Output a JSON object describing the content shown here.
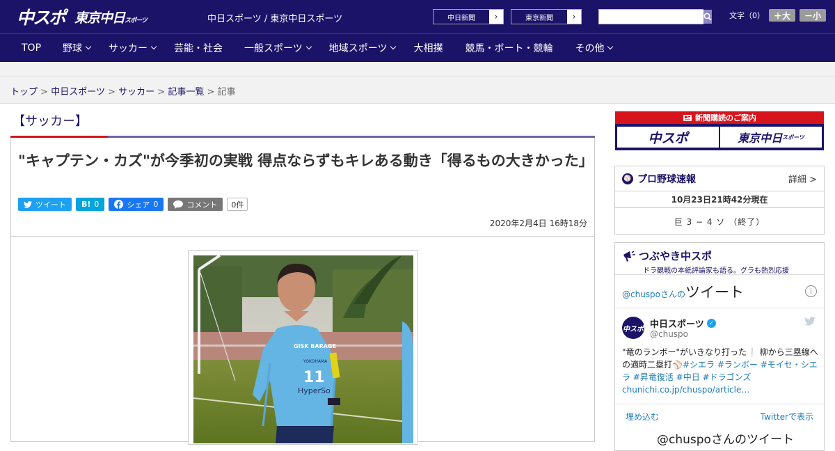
{
  "header": {
    "logo_primary": "中スポ",
    "logo_secondary": "東京中日",
    "logo_secondary_small": "スポーツ",
    "site_title": "中日スポーツ / 東京中日スポーツ",
    "paper_links": [
      "中日新聞",
      "東京新聞"
    ],
    "search": {
      "placeholder": ""
    },
    "font_label": "文字（0）",
    "font_larger": "＋大",
    "font_smaller": "－小"
  },
  "nav": {
    "items": [
      {
        "label": "TOP",
        "has_dropdown": false
      },
      {
        "label": "野球",
        "has_dropdown": true
      },
      {
        "label": "サッカー",
        "has_dropdown": true
      },
      {
        "label": "芸能・社会",
        "has_dropdown": false
      },
      {
        "label": "一般スポーツ",
        "has_dropdown": true
      },
      {
        "label": "地域スポーツ",
        "has_dropdown": true
      },
      {
        "label": "大相撲",
        "has_dropdown": false
      },
      {
        "label": "競馬・ボート・競輪",
        "has_dropdown": false
      },
      {
        "label": "その他",
        "has_dropdown": true
      }
    ]
  },
  "breadcrumb": {
    "items": [
      "トップ",
      "中日スポーツ",
      "サッカー",
      "記事一覧"
    ],
    "current": "記事",
    "separator": ">"
  },
  "article": {
    "category": "【サッカー】",
    "headline": "\"キャプテン・カズ\"が今季初の実戦 得点ならずもキレある動き「得るもの大きかった」",
    "share": {
      "twitter": "ツイート",
      "hatena": "B!",
      "hatena_count": "0",
      "facebook": "シェア",
      "facebook_count": "0",
      "comment": "コメント",
      "comment_count": "0件"
    },
    "date": "2020年2月4日 16時18分",
    "photo_text": {
      "jersey_sponsor": "GISK BARAGE",
      "jersey_city": "YOKOHAMA",
      "jersey_number": "11",
      "jersey_brand": "HyperSo"
    }
  },
  "sidebar": {
    "subscription": {
      "header": "新聞購読のご案内",
      "left": "中スポ",
      "right": "東京中日",
      "right_small": "スポーツ"
    },
    "baseball": {
      "title": "プロ野球速報",
      "details": "詳細 >",
      "time": "10月23日21時42分現在",
      "score": "巨 3 − 4 ソ （終了）"
    },
    "tsubuyaki": {
      "title": "つぶやき中スポ",
      "subtitle": "ドラ観戦の本紙評論家も語る。グラも熱烈応援"
    },
    "twitter": {
      "header_prefix": "@chuspoさんの",
      "header_main": "ツイート",
      "name": "中日スポーツ",
      "handle": "@chuspo",
      "avatar_text": "中スポ",
      "text_plain": "\"竜のランボー\"がいきなり打った❕ 柳から三塁線への適時二塁打⚾",
      "hashtags": "#シエラ #ランボー #モイセ・シエラ #昇竜復活 #中日 #ドラゴンズ",
      "link": "chunichi.co.jp/chuspo/article…",
      "embed": "埋め込む",
      "view_on": "Twitterで表示",
      "next_header": "@chuspoさんのツイート"
    }
  },
  "colors": {
    "brand_navy": "#1b1368",
    "accent_red": "#d7141b",
    "twitter_blue": "#1da1f2",
    "facebook_blue": "#1877f2",
    "hatena_blue": "#00a4de"
  }
}
